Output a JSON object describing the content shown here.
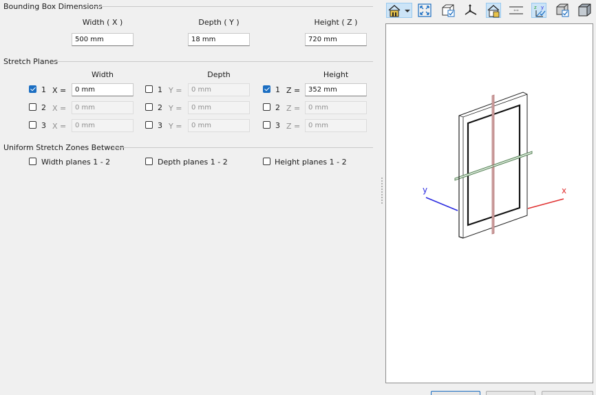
{
  "bounding_box": {
    "title": "Bounding Box Dimensions",
    "columns": [
      {
        "label": "Width ( X )",
        "value": "500 mm"
      },
      {
        "label": "Depth ( Y )",
        "value": "18 mm"
      },
      {
        "label": "Height ( Z )",
        "value": "720 mm"
      }
    ]
  },
  "stretch_planes": {
    "title": "Stretch Planes",
    "groups": [
      {
        "label": "Width",
        "rows": [
          {
            "num": "1",
            "axis": "X =",
            "value": "0 mm",
            "checked": true,
            "enabled": true
          },
          {
            "num": "2",
            "axis": "X =",
            "value": "0 mm",
            "checked": false,
            "enabled": false
          },
          {
            "num": "3",
            "axis": "X =",
            "value": "0 mm",
            "checked": false,
            "enabled": false
          }
        ]
      },
      {
        "label": "Depth",
        "rows": [
          {
            "num": "1",
            "axis": "Y =",
            "value": "0 mm",
            "checked": false,
            "enabled": false
          },
          {
            "num": "2",
            "axis": "Y =",
            "value": "0 mm",
            "checked": false,
            "enabled": false
          },
          {
            "num": "3",
            "axis": "Y =",
            "value": "0 mm",
            "checked": false,
            "enabled": false
          }
        ]
      },
      {
        "label": "Height",
        "rows": [
          {
            "num": "1",
            "axis": "Z =",
            "value": "352 mm",
            "checked": true,
            "enabled": true
          },
          {
            "num": "2",
            "axis": "Z =",
            "value": "0 mm",
            "checked": false,
            "enabled": false
          },
          {
            "num": "3",
            "axis": "Z =",
            "value": "0 mm",
            "checked": false,
            "enabled": false
          }
        ]
      }
    ]
  },
  "uniform_zones": {
    "title": "Uniform Stretch Zones Between",
    "options": [
      {
        "label": "Width planes 1 - 2",
        "checked": false
      },
      {
        "label": "Depth planes 1 - 2",
        "checked": false
      },
      {
        "label": "Height planes 1 - 2",
        "checked": false
      }
    ]
  },
  "toolbar": {
    "tools": [
      {
        "icon": "home-view-icon",
        "active": true
      },
      {
        "icon": "zoom-fit-icon",
        "active": false
      },
      {
        "icon": "bounding-box-toggle-icon",
        "active": false
      },
      {
        "icon": "axes-toggle-icon",
        "active": false
      },
      {
        "icon": "home-lock-icon",
        "active": true
      },
      {
        "icon": "stretch-planes-icon",
        "active": false
      },
      {
        "icon": "axis-labels-icon",
        "active": true
      },
      {
        "icon": "grid-box-icon",
        "active": false
      },
      {
        "icon": "solid-view-icon",
        "active": false
      }
    ]
  },
  "viewport": {
    "axis_labels": {
      "x": "x",
      "y": "y"
    },
    "colors": {
      "x_axis": "#e03030",
      "y_axis": "#2a2ae0",
      "x_plane": "#b07070",
      "z_plane": "#4a7a4a",
      "outline": "#111111"
    }
  }
}
